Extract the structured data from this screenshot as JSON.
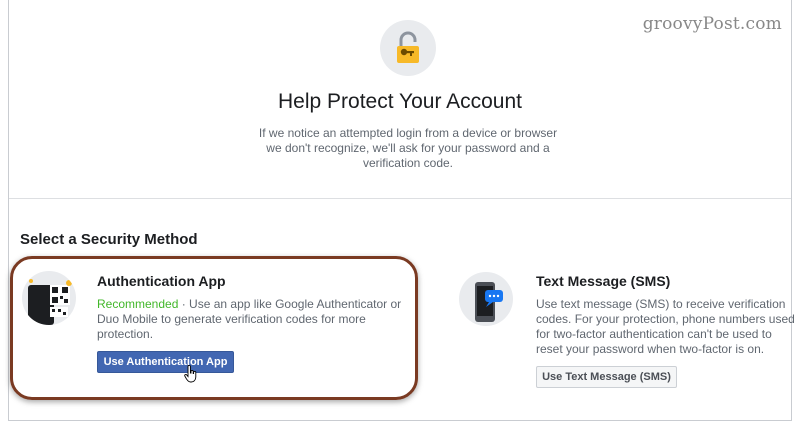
{
  "watermark": "groovyPost.com",
  "header": {
    "title": "Help Protect Your Account",
    "description": "If we notice an attempted login from a device or browser we don't recognize, we'll ask for your password and a verification code."
  },
  "section": {
    "title": "Select a Security Method"
  },
  "methods": {
    "auth_app": {
      "title": "Authentication App",
      "recommended": "Recommended",
      "description": " · Use an app like Google Authenticator or Duo Mobile to generate verification codes for more protection.",
      "button_label": "Use Authentication App",
      "icon": "qr-phone-icon"
    },
    "sms": {
      "title": "Text Message (SMS)",
      "description": "Use text message (SMS) to receive verification codes. For your protection, phone numbers used for two-factor authentication can't be used to reset your password when two-factor is on.",
      "button_label": "Use Text Message (SMS)",
      "icon": "phone-chat-icon"
    }
  },
  "colors": {
    "primary_button": "#4267b2",
    "recommended": "#42b72a",
    "highlight_border": "#7a3a22",
    "lock": "#f7b928"
  }
}
